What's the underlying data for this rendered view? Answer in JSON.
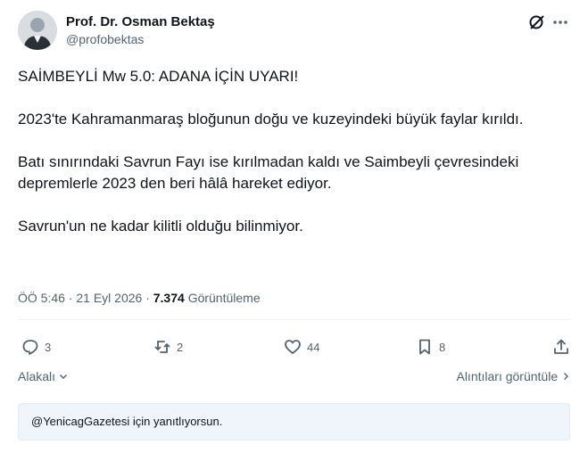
{
  "author": {
    "name": "Prof. Dr. Osman Bektaş",
    "handle": "@profobektas"
  },
  "tweet": {
    "paragraphs": [
      "SAİMBEYLİ Mw 5.0: ADANA İÇİN UYARI!",
      "2023'te Kahramanmaraş bloğunun doğu ve kuzeyindeki büyük faylar kırıldı.",
      "Batı sınırındaki Savrun Fayı ise kırılmadan kaldı ve Saimbeyli çevresindeki depremlerle 2023 den beri hâlâ hareket ediyor.",
      "Savrun'un ne kadar kilitli olduğu bilinmiyor."
    ],
    "time": "ÖÖ 5:46 · 21 Eyl 2026 ·",
    "views_count": "7.374",
    "views_label": "Görüntüleme"
  },
  "actions": {
    "replies": "3",
    "reposts": "2",
    "likes": "44",
    "bookmarks": "8"
  },
  "sort_label": "Alakalı",
  "quotes_label": "Alıntıları görüntüle",
  "reply_banner": "@YenicagGazetesi için yanıtlıyorsun.",
  "colors": {
    "text": "#0f1419",
    "secondary": "#536471",
    "banner_bg": "#eef6fc"
  },
  "icons": [
    "grok-icon",
    "more-icon",
    "reply-icon",
    "repost-icon",
    "like-icon",
    "bookmark-icon",
    "share-icon",
    "chevron-down-icon",
    "chevron-right-icon"
  ]
}
